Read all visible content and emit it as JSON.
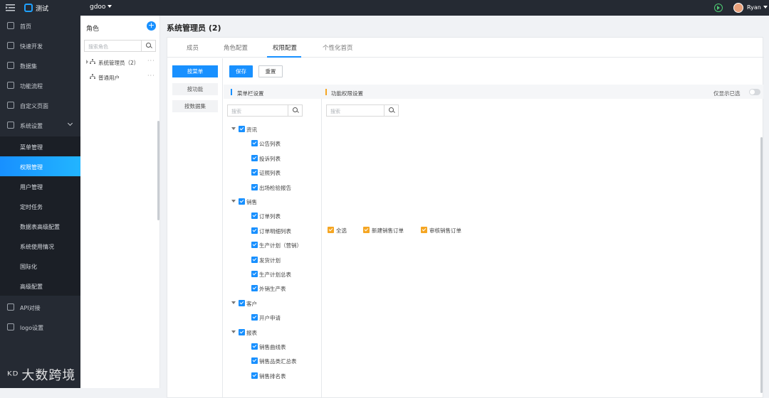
{
  "topbar": {
    "app_title": "测试",
    "space": "gdoo",
    "user": "Ryan"
  },
  "sidebar": {
    "items": [
      {
        "label": "首页",
        "name": "home"
      },
      {
        "label": "快速开发",
        "name": "quick-dev"
      },
      {
        "label": "数据集",
        "name": "dataset"
      },
      {
        "label": "功能流程",
        "name": "workflow"
      },
      {
        "label": "自定义页面",
        "name": "custom-page"
      },
      {
        "label": "系统设置",
        "name": "system-settings"
      }
    ],
    "sub_items": [
      {
        "label": "菜单管理",
        "name": "menu-mgmt"
      },
      {
        "label": "权限管理",
        "name": "permission-mgmt"
      },
      {
        "label": "用户管理",
        "name": "user-mgmt"
      },
      {
        "label": "定时任务",
        "name": "scheduled-tasks"
      },
      {
        "label": "数据表高级配置",
        "name": "table-config"
      },
      {
        "label": "系统使用情况",
        "name": "system-usage"
      },
      {
        "label": "国际化",
        "name": "i18n"
      },
      {
        "label": "高级配置",
        "name": "advanced-config"
      }
    ],
    "bottom_items": [
      {
        "label": "API对接",
        "name": "api"
      },
      {
        "label": "logo设置",
        "name": "logo-settings"
      }
    ],
    "watermark": "大数跨境"
  },
  "roles": {
    "title": "角色",
    "search_placeholder": "搜索角色",
    "items": [
      {
        "label": "系统管理员（2）"
      },
      {
        "label": "普通用户"
      }
    ]
  },
  "main": {
    "title": "系统管理员 (2)",
    "tabs": [
      {
        "label": "成员"
      },
      {
        "label": "角色配置"
      },
      {
        "label": "权限配置"
      },
      {
        "label": "个性化首页"
      }
    ],
    "left_nav": [
      {
        "label": "按菜单"
      },
      {
        "label": "按功能"
      },
      {
        "label": "按数据集"
      }
    ],
    "save_label": "保存",
    "reset_label": "重置",
    "menu_section": "菜单栏设置",
    "func_section": "功能权限设置",
    "show_selected": "仅显示已选",
    "search_placeholder": "搜索",
    "tree": [
      {
        "label": "资讯",
        "level": 0
      },
      {
        "label": "公告列表",
        "level": 1
      },
      {
        "label": "投诉列表",
        "level": 1
      },
      {
        "label": "证照列表",
        "level": 1
      },
      {
        "label": "出场检验报告",
        "level": 1
      },
      {
        "label": "销售",
        "level": 0
      },
      {
        "label": "订单列表",
        "level": 1
      },
      {
        "label": "订单明细列表",
        "level": 1
      },
      {
        "label": "生产计划（营销）",
        "level": 1
      },
      {
        "label": "发货计划",
        "level": 1
      },
      {
        "label": "生产计划总表",
        "level": 1
      },
      {
        "label": "外销生产表",
        "level": 1
      },
      {
        "label": "客户",
        "level": 0
      },
      {
        "label": "开户申请",
        "level": 1
      },
      {
        "label": "报表",
        "level": 0
      },
      {
        "label": "销售曲线表",
        "level": 1
      },
      {
        "label": "销售品类汇总表",
        "level": 1
      },
      {
        "label": "销售排名表",
        "level": 1
      }
    ],
    "functions": [
      {
        "label": "全选"
      },
      {
        "label": "新建销售订单"
      },
      {
        "label": "审核销售订单"
      }
    ]
  },
  "colors": {
    "accent": "#1890ff",
    "sidebar_bg": "#252a33",
    "func_check": "#f5a623"
  }
}
